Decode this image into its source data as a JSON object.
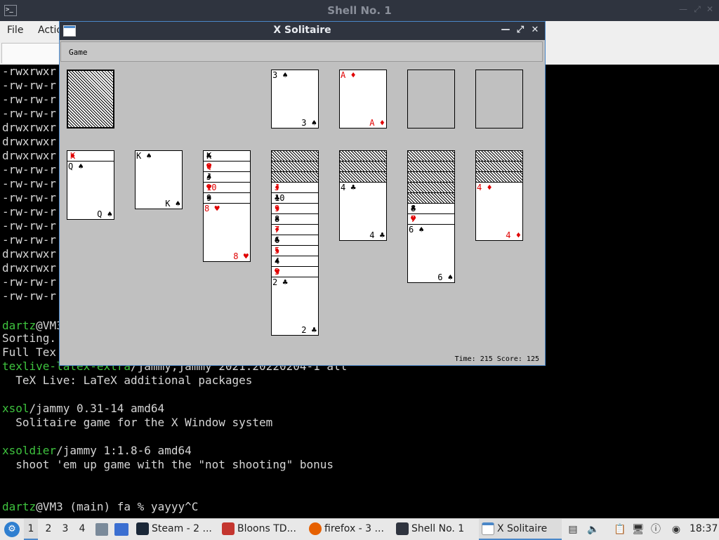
{
  "terminal": {
    "title": "Shell No. 1",
    "app_icon": ">_",
    "menu": {
      "file": "File",
      "actions": "Actio"
    },
    "lines": [
      {
        "text": "-rwxrwxr"
      },
      {
        "text": "-rw-rw-r"
      },
      {
        "text": "-rw-rw-r"
      },
      {
        "text": "-rw-rw-r"
      },
      {
        "text": "drwxrwxr"
      },
      {
        "text": "drwxrwxr"
      },
      {
        "text": "drwxrwxr"
      },
      {
        "text": "-rw-rw-r"
      },
      {
        "text": "-rw-rw-r"
      },
      {
        "text": "-rw-rw-r"
      },
      {
        "text": "-rw-rw-r"
      },
      {
        "text": "-rw-rw-r"
      },
      {
        "text": "-rw-rw-r"
      },
      {
        "text": "drwxrwxr"
      },
      {
        "text": "drwxrwxr"
      },
      {
        "text": "-rw-rw-r"
      },
      {
        "text": "-rw-rw-r"
      }
    ],
    "prompt1_user": "dartz",
    "prompt1_rest": "@VM3",
    "sorting": "Sorting.",
    "fulltext": "Full Tex",
    "pkg1_name": "texlive-latex-extra",
    "pkg1_rest": "/jammy,jammy 2021.20220204-1 all",
    "pkg1_desc": "  TeX Live: LaTeX additional packages",
    "pkg2_name": "xsol",
    "pkg2_rest": "/jammy 0.31-14 amd64",
    "pkg2_desc": "  Solitaire game for the X Window system",
    "pkg3_name": "xsoldier",
    "pkg3_rest": "/jammy 1:1.8-6 amd64",
    "pkg3_desc": "  shoot 'em up game with the \"not shooting\" bonus",
    "prompt2_user": "dartz",
    "prompt2_rest": "@VM3 (main) fa % yayyy^C"
  },
  "solitaire": {
    "title": "X Solitaire",
    "menu_game": "Game",
    "status": "Time: 215 Score: 125",
    "foundations": [
      {
        "rank": "3",
        "suit": "♠",
        "color": "black"
      },
      {
        "rank": "A",
        "suit": "♦",
        "color": "red"
      }
    ],
    "columns": [
      {
        "hidden": 0,
        "cards": [
          {
            "rank": "K",
            "suit": "♦",
            "color": "red"
          },
          {
            "rank": "Q",
            "suit": "♠",
            "color": "black"
          }
        ]
      },
      {
        "hidden": 0,
        "cards": [
          {
            "rank": "K",
            "suit": "♠",
            "color": "black"
          }
        ]
      },
      {
        "hidden": 0,
        "cards": [
          {
            "rank": "K",
            "suit": "♣",
            "color": "black"
          },
          {
            "rank": "Q",
            "suit": "♥",
            "color": "red"
          },
          {
            "rank": "J",
            "suit": "♠",
            "color": "black"
          },
          {
            "rank": "10",
            "suit": "♥",
            "color": "red"
          },
          {
            "rank": "9",
            "suit": "♠",
            "color": "black"
          },
          {
            "rank": "8",
            "suit": "♥",
            "color": "red"
          }
        ]
      },
      {
        "hidden": 3,
        "cards": [
          {
            "rank": "J",
            "suit": "♦",
            "color": "red"
          },
          {
            "rank": "10",
            "suit": "♣",
            "color": "black"
          },
          {
            "rank": "9",
            "suit": "♦",
            "color": "red"
          },
          {
            "rank": "8",
            "suit": "♠",
            "color": "black"
          },
          {
            "rank": "7",
            "suit": "♦",
            "color": "red"
          },
          {
            "rank": "6",
            "suit": "♣",
            "color": "black"
          },
          {
            "rank": "5",
            "suit": "♦",
            "color": "red"
          },
          {
            "rank": "4",
            "suit": "♠",
            "color": "black"
          },
          {
            "rank": "3",
            "suit": "♥",
            "color": "red"
          },
          {
            "rank": "2",
            "suit": "♣",
            "color": "black"
          }
        ]
      },
      {
        "hidden": 3,
        "cards": [
          {
            "rank": "4",
            "suit": "♣",
            "color": "black"
          }
        ]
      },
      {
        "hidden": 5,
        "cards": [
          {
            "rank": "8",
            "suit": "♣",
            "color": "black"
          },
          {
            "rank": "7",
            "suit": "♥",
            "color": "red"
          },
          {
            "rank": "6",
            "suit": "♠",
            "color": "black"
          }
        ]
      },
      {
        "hidden": 3,
        "cards": [
          {
            "rank": "4",
            "suit": "♦",
            "color": "red"
          }
        ]
      }
    ]
  },
  "taskbar": {
    "workspaces": [
      "1",
      "2",
      "3",
      "4"
    ],
    "tasks": [
      {
        "label": "Steam - 2 ...",
        "icon": "steam-icon"
      },
      {
        "label": "Bloons TD...",
        "icon": "bloons-icon"
      },
      {
        "label": "firefox - 3 ...",
        "icon": "firefox-icon"
      },
      {
        "label": "Shell No. 1",
        "icon": "terminal-icon"
      },
      {
        "label": "X Solitaire",
        "icon": "window-icon"
      }
    ],
    "clock": "18:37"
  }
}
